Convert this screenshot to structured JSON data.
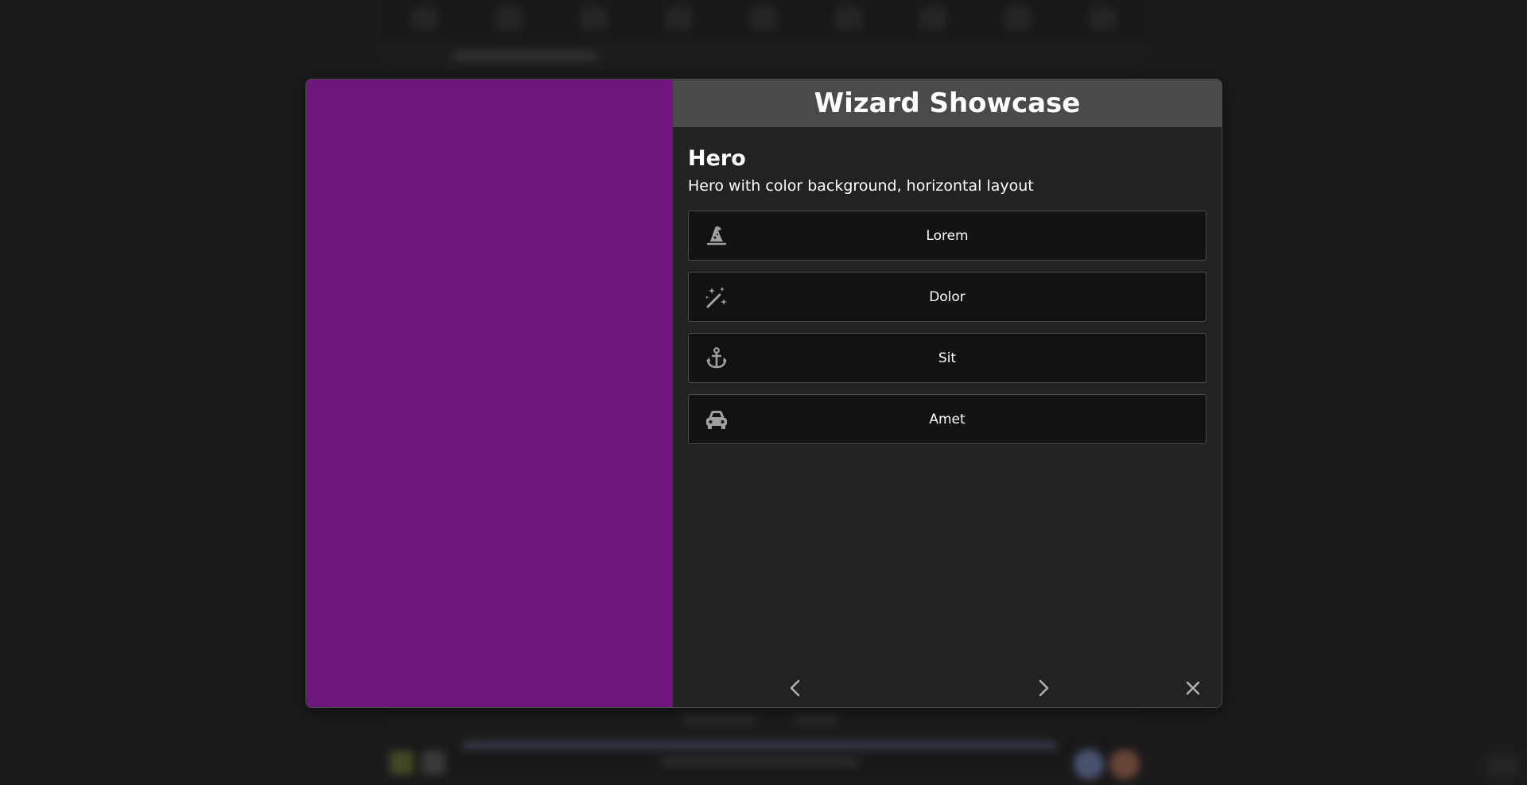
{
  "colors": {
    "hero_background": "#6e187d",
    "title_bar": "#4a4a4a",
    "option_background": "#121212",
    "icon": "#a0a0a0"
  },
  "wizard": {
    "title": "Wizard Showcase",
    "heading": "Hero",
    "description": "Hero with color background, horizontal layout",
    "options": [
      {
        "label": "Lorem",
        "icon": "wizard-hat-icon"
      },
      {
        "label": "Dolor",
        "icon": "magic-wand-icon"
      },
      {
        "label": "Sit",
        "icon": "anchor-icon"
      },
      {
        "label": "Amet",
        "icon": "car-icon"
      }
    ],
    "footer": {
      "prev_icon": "chevron-left-icon",
      "next_icon": "chevron-right-icon",
      "close_icon": "close-icon"
    }
  }
}
